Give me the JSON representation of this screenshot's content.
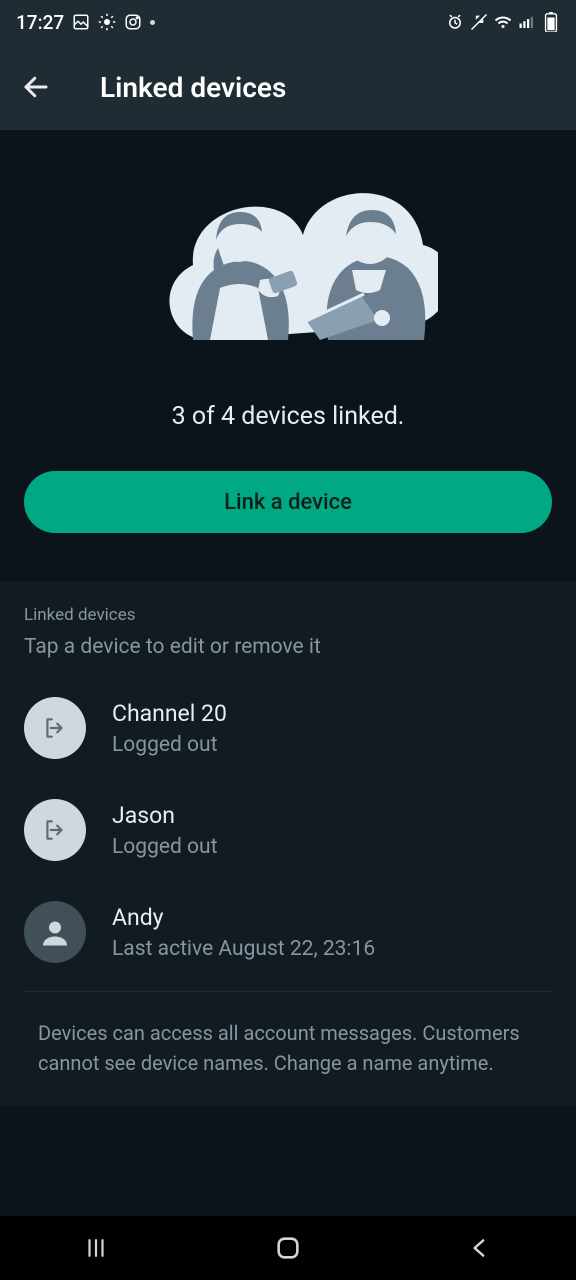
{
  "status": {
    "time": "17:27"
  },
  "header": {
    "title": "Linked devices"
  },
  "hero": {
    "summary": "3 of 4 devices linked.",
    "cta": "Link a device"
  },
  "list": {
    "heading": "Linked devices",
    "subheading": "Tap a device to edit or remove it",
    "devices": [
      {
        "name": "Channel 20",
        "status": "Logged out"
      },
      {
        "name": "Jason",
        "status": "Logged out"
      },
      {
        "name": "Andy",
        "status": "Last active August 22, 23:16"
      }
    ],
    "footnote": "Devices can access all account messages. Customers cannot see device names. Change a name anytime."
  }
}
